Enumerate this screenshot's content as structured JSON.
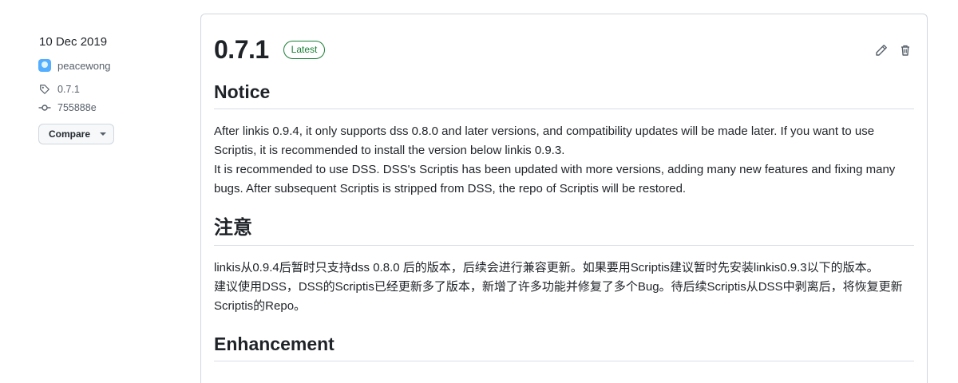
{
  "sidebar": {
    "date": "10 Dec 2019",
    "author": "peacewong",
    "tag": "0.7.1",
    "commit": "755888e",
    "compare_label": "Compare"
  },
  "release": {
    "version": "0.7.1",
    "badge": "Latest",
    "sections": {
      "notice_heading": "Notice",
      "notice_lines": [
        "After linkis 0.9.4, it only supports dss 0.8.0 and later versions, and compatibility updates will be made later. If you want to use Scriptis, it is recommended to install the version below linkis 0.9.3.",
        "It is recommended to use DSS. DSS's Scriptis has been updated with more versions, adding many new features and fixing many bugs. After subsequent Scriptis is stripped from DSS, the repo of Scriptis will be restored."
      ],
      "cn_heading": "注意",
      "cn_lines": [
        "linkis从0.9.4后暂时只支持dss 0.8.0 后的版本，后续会进行兼容更新。如果要用Scriptis建议暂时先安装linkis0.9.3以下的版本。",
        "建议使用DSS，DSS的Scriptis已经更新多了版本，新增了许多功能并修复了多个Bug。待后续Scriptis从DSS中剥离后，将恢复更新Scriptis的Repo。"
      ],
      "enhancement_heading": "Enhancement"
    }
  },
  "icons": {
    "tag": "tag-icon",
    "commit": "git-commit-icon",
    "edit": "pencil-icon",
    "delete": "trash-icon",
    "avatar": "avatar"
  },
  "colors": {
    "badge_green": "#1a7f37",
    "border": "#d0d7de",
    "muted": "#57606a",
    "text": "#1f2328"
  }
}
